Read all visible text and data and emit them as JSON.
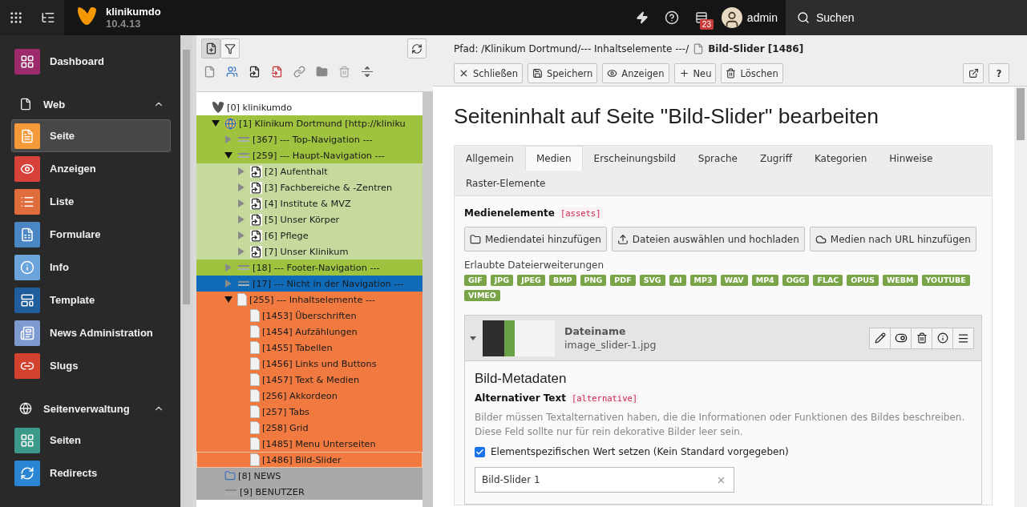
{
  "topbar": {
    "site_name": "klinikumdo",
    "version": "10.4.13",
    "notification_count": "23",
    "user": "admin",
    "search_label": "Suchen"
  },
  "sidebar": {
    "modules": [
      {
        "label": "Dashboard",
        "color": "#9d2a6a",
        "selected": false
      }
    ],
    "groups": [
      {
        "label": "Web",
        "expanded": true,
        "modules": [
          {
            "label": "Seite",
            "color": "#f49a3a",
            "selected": true
          },
          {
            "label": "Anzeigen",
            "color": "#d8403a",
            "selected": false
          },
          {
            "label": "Liste",
            "color": "#e06e3c",
            "selected": false
          },
          {
            "label": "Formulare",
            "color": "#4a86c4",
            "selected": false
          },
          {
            "label": "Info",
            "color": "#6ba3db",
            "selected": false
          },
          {
            "label": "Template",
            "color": "#1f5e9a",
            "selected": false
          },
          {
            "label": "News Administration",
            "color": "#7d9bd1",
            "selected": false
          },
          {
            "label": "Slugs",
            "color": "#d2422f",
            "selected": false
          }
        ]
      },
      {
        "label": "Seitenverwaltung",
        "expanded": true,
        "modules": [
          {
            "label": "Seiten",
            "color": "#3b9a89",
            "selected": false
          },
          {
            "label": "Redirects",
            "color": "#2a86d4",
            "selected": false
          }
        ]
      }
    ]
  },
  "tree_toolbar": {
    "buttons": [
      {
        "selected": true
      },
      {
        "selected": false
      }
    ]
  },
  "tree": {
    "items": [
      {
        "label": "[0] klinikumdo",
        "kind": "root",
        "selected": false,
        "children": [
          {
            "label": "[1] Klinikum Dortmund [http://kliniku",
            "kind": "site",
            "expanded": true,
            "color": "#9fc23f",
            "selected": false,
            "children": [
              {
                "label": "[367] --- Top-Navigation ---",
                "kind": "spacer",
                "expanded": false,
                "color": "#9fc23f",
                "selected": false
              },
              {
                "label": "[259] --- Haupt-Navigation ---",
                "kind": "spacer",
                "expanded": true,
                "color": "#9fc23f",
                "selected": false,
                "children": [
                  {
                    "label": "[2] Aufenthalt",
                    "kind": "shortcut",
                    "expanded": false,
                    "color": "#c6da9d",
                    "selected": false
                  },
                  {
                    "label": "[3] Fachbereiche & -Zentren",
                    "kind": "shortcut",
                    "expanded": false,
                    "color": "#c6da9d",
                    "selected": false
                  },
                  {
                    "label": "[4] Institute & MVZ",
                    "kind": "shortcut",
                    "expanded": false,
                    "color": "#c6da9d",
                    "selected": false
                  },
                  {
                    "label": "[5] Unser Körper",
                    "kind": "shortcut",
                    "expanded": false,
                    "color": "#c6da9d",
                    "selected": false
                  },
                  {
                    "label": "[6] Pflege",
                    "kind": "shortcut",
                    "expanded": false,
                    "color": "#c6da9d",
                    "selected": false
                  },
                  {
                    "label": "[7] Unser Klinikum",
                    "kind": "shortcut",
                    "expanded": false,
                    "color": "#c6da9d",
                    "selected": false
                  }
                ]
              },
              {
                "label": "[18] --- Footer-Navigation ---",
                "kind": "spacer",
                "expanded": false,
                "color": "#9fc23f",
                "selected": false
              },
              {
                "label": "[17] --- Nicht in der Navigation ---",
                "kind": "spacer",
                "expanded": false,
                "color": "#0f6ab8",
                "selected": false
              },
              {
                "label": "[255] --- Inhaltselemente ---",
                "kind": "page",
                "expanded": true,
                "color": "#f07a40",
                "selected": false,
                "children": [
                  {
                    "label": "[1453] Überschriften",
                    "kind": "page",
                    "color": "#f07a40",
                    "selected": false
                  },
                  {
                    "label": "[1454] Aufzählungen",
                    "kind": "page",
                    "color": "#f07a40",
                    "selected": false
                  },
                  {
                    "label": "[1455] Tabellen",
                    "kind": "page",
                    "color": "#f07a40",
                    "selected": false
                  },
                  {
                    "label": "[1456] Links und Buttons",
                    "kind": "page",
                    "color": "#f07a40",
                    "selected": false
                  },
                  {
                    "label": "[1457] Text & Medien",
                    "kind": "page",
                    "color": "#f07a40",
                    "selected": false
                  },
                  {
                    "label": "[256] Akkordeon",
                    "kind": "page",
                    "color": "#f07a40",
                    "selected": false
                  },
                  {
                    "label": "[257] Tabs",
                    "kind": "page",
                    "color": "#f07a40",
                    "selected": false
                  },
                  {
                    "label": "[258] Grid",
                    "kind": "page",
                    "color": "#f07a40",
                    "selected": false
                  },
                  {
                    "label": "[1485] Menu Unterseiten",
                    "kind": "page",
                    "color": "#f07a40",
                    "selected": false
                  },
                  {
                    "label": "[1486] Bild-Slider",
                    "kind": "page",
                    "color": "#f07a40",
                    "selected": true
                  }
                ]
              }
            ]
          },
          {
            "label": "[8] NEWS",
            "kind": "folder",
            "color": "#a9a9a9",
            "selected": false
          },
          {
            "label": "[9] BENUTZER",
            "kind": "spacer",
            "color": "#a9a9a9",
            "selected": false
          }
        ]
      }
    ]
  },
  "docheader": {
    "path": "Pfad: /Klinikum Dortmund/--- Inhaltselemente ---/",
    "record": "Bild-Slider [1486]",
    "buttons": [
      "Schließen",
      "Speichern",
      "Anzeigen",
      "Neu",
      "Löschen"
    ],
    "help_label": "?"
  },
  "title": "Seiteninhalt auf Seite \"Bild-Slider\" bearbeiten",
  "tabs": [
    {
      "label": "Allgemein",
      "selected": false
    },
    {
      "label": "Medien",
      "selected": true
    },
    {
      "label": "Erscheinungsbild",
      "selected": false
    },
    {
      "label": "Sprache",
      "selected": false
    },
    {
      "label": "Zugriff",
      "selected": false
    },
    {
      "label": "Kategorien",
      "selected": false
    },
    {
      "label": "Hinweise",
      "selected": false
    },
    {
      "label": "Raster-Elemente",
      "selected": false
    }
  ],
  "media": {
    "label": "Medienelemente",
    "field_name": "[assets]",
    "buttons": [
      "Mediendatei hinzufügen",
      "Dateien auswählen und hochladen",
      "Medien nach URL hinzufügen"
    ],
    "allowed_label": "Erlaubte Dateierweiterungen",
    "extensions": [
      "GIF",
      "JPG",
      "JPEG",
      "BMP",
      "PNG",
      "PDF",
      "SVG",
      "AI",
      "MP3",
      "WAV",
      "MP4",
      "OGG",
      "FLAC",
      "OPUS",
      "WEBM",
      "YOUTUBE",
      "VIMEO"
    ],
    "file": {
      "name_label": "Dateiname",
      "filename": "image_slider-1.jpg",
      "expanded": true,
      "metadata": {
        "title": "Bild-Metadaten",
        "field_label": "Alternativer Text",
        "field_name": "[alternative]",
        "description": "Bilder müssen Textalternativen haben, die die Informationen oder Funktionen des Bildes beschreiben. Diese Feld sollte nur für rein dekorative Bilder leer sein.",
        "checkbox": {
          "label": "Elementspezifischen Wert setzen (Kein Standard vorgegeben)",
          "checked": true
        },
        "value": "Bild-Slider 1"
      }
    }
  }
}
